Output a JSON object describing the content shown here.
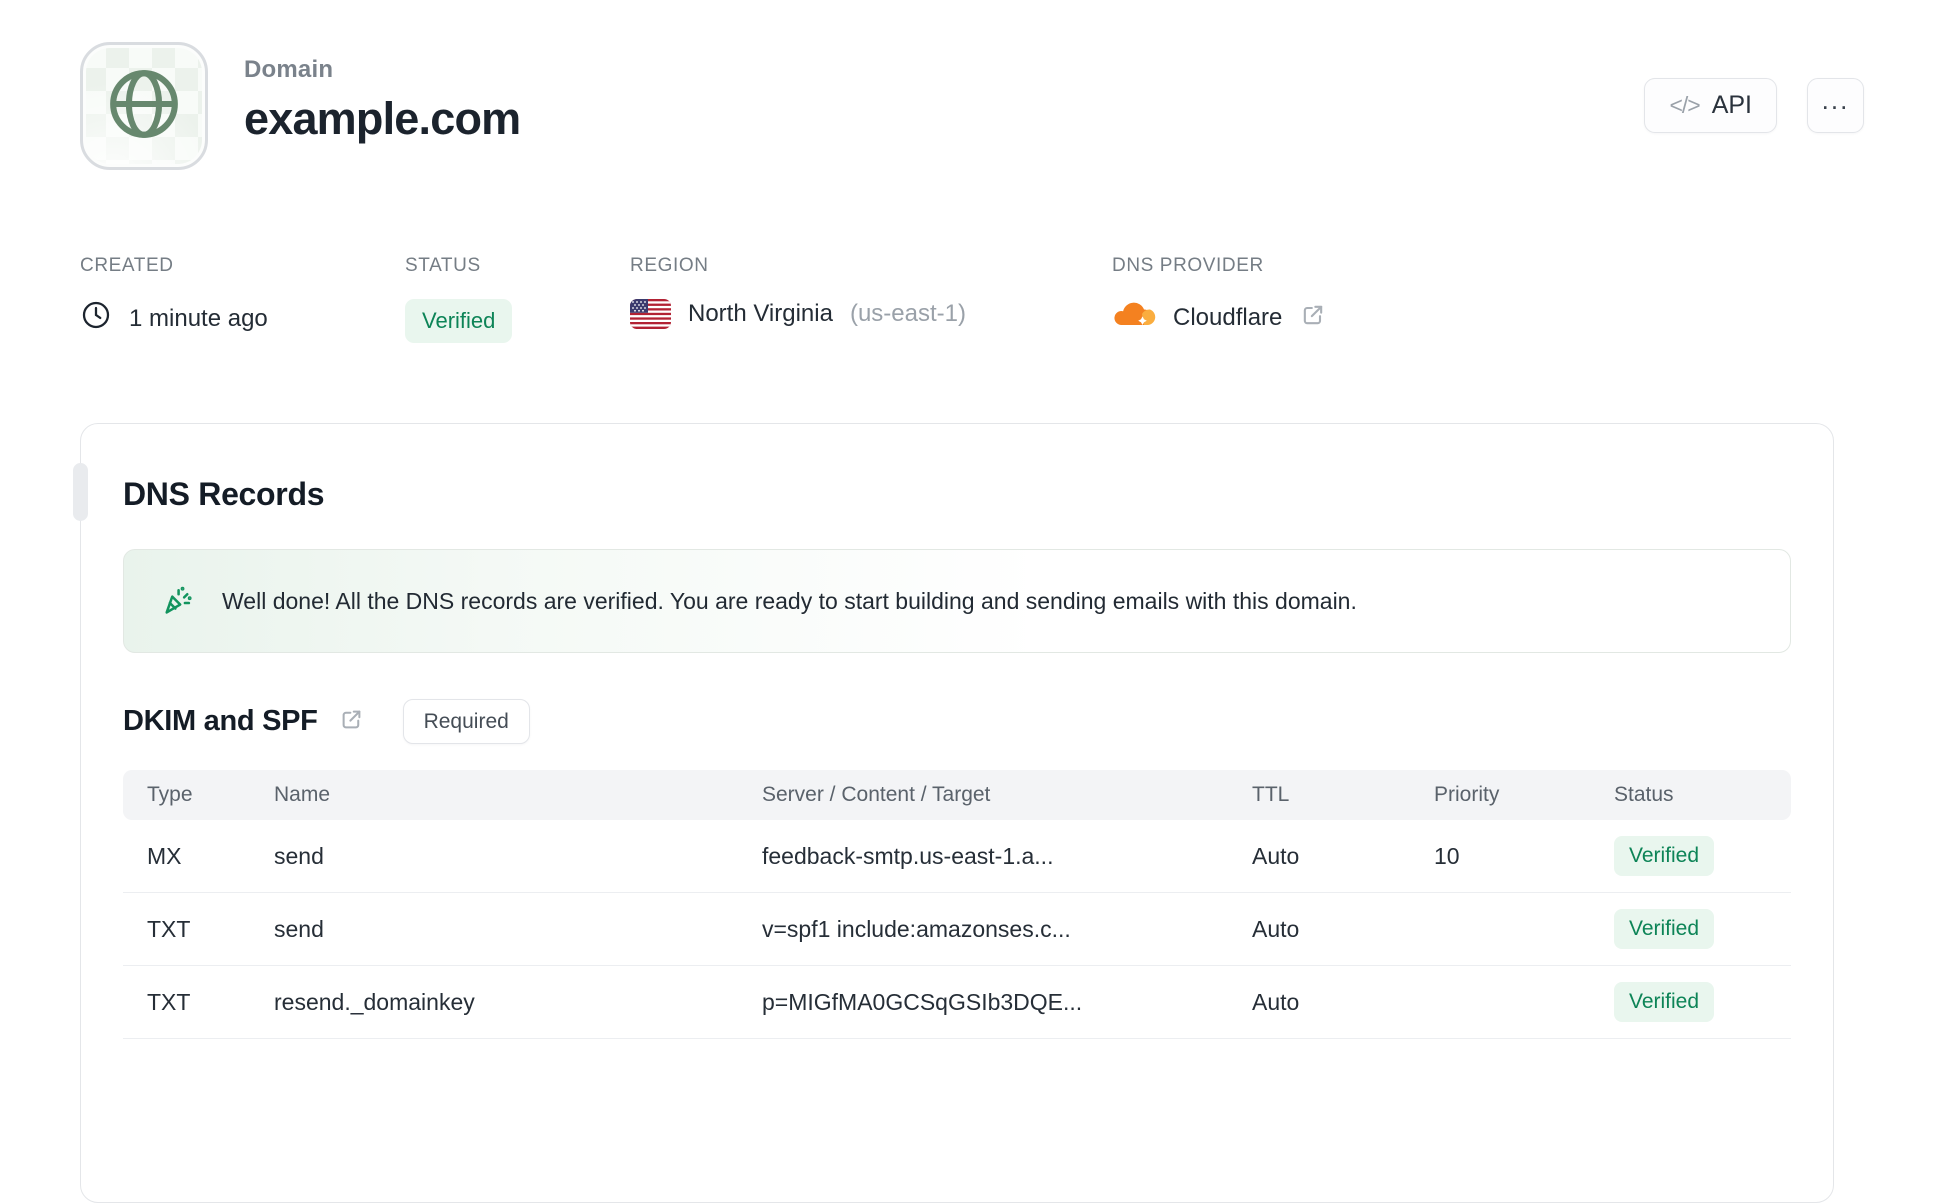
{
  "header": {
    "label": "Domain",
    "title": "example.com",
    "api_button_label": "API",
    "api_icon_glyph": "</>",
    "more_icon_glyph": "..."
  },
  "meta": {
    "created": {
      "label": "CREATED",
      "value": "1 minute ago"
    },
    "status": {
      "label": "STATUS",
      "value": "Verified"
    },
    "region": {
      "label": "REGION",
      "value": "North Virginia",
      "code": "(us-east-1)"
    },
    "dns_provider": {
      "label": "DNS PROVIDER",
      "value": "Cloudflare"
    }
  },
  "dns_card": {
    "title": "DNS Records",
    "banner_message": "Well done! All the DNS records are verified. You are ready to start building and sending emails with this domain.",
    "section": {
      "title": "DKIM and SPF",
      "badge": "Required"
    },
    "table": {
      "headers": [
        "Type",
        "Name",
        "Server / Content / Target",
        "TTL",
        "Priority",
        "Status"
      ],
      "rows": [
        {
          "type": "MX",
          "name": "send",
          "content": "feedback-smtp.us-east-1.a...",
          "ttl": "Auto",
          "priority": "10",
          "status": "Verified"
        },
        {
          "type": "TXT",
          "name": "send",
          "content": "v=spf1 include:amazonses.c...",
          "ttl": "Auto",
          "priority": "",
          "status": "Verified"
        },
        {
          "type": "TXT",
          "name": "resend._domainkey",
          "content": "p=MIGfMA0GCSqGSIb3DQE...",
          "ttl": "Auto",
          "priority": "",
          "status": "Verified"
        }
      ]
    }
  },
  "colors": {
    "accent_green": "#0d8457",
    "badge_bg": "#e9f6ee",
    "globe_green": "#67886e",
    "cloudflare_orange": "#f48120",
    "border": "#e4e6e9",
    "muted_text": "#757d85"
  }
}
